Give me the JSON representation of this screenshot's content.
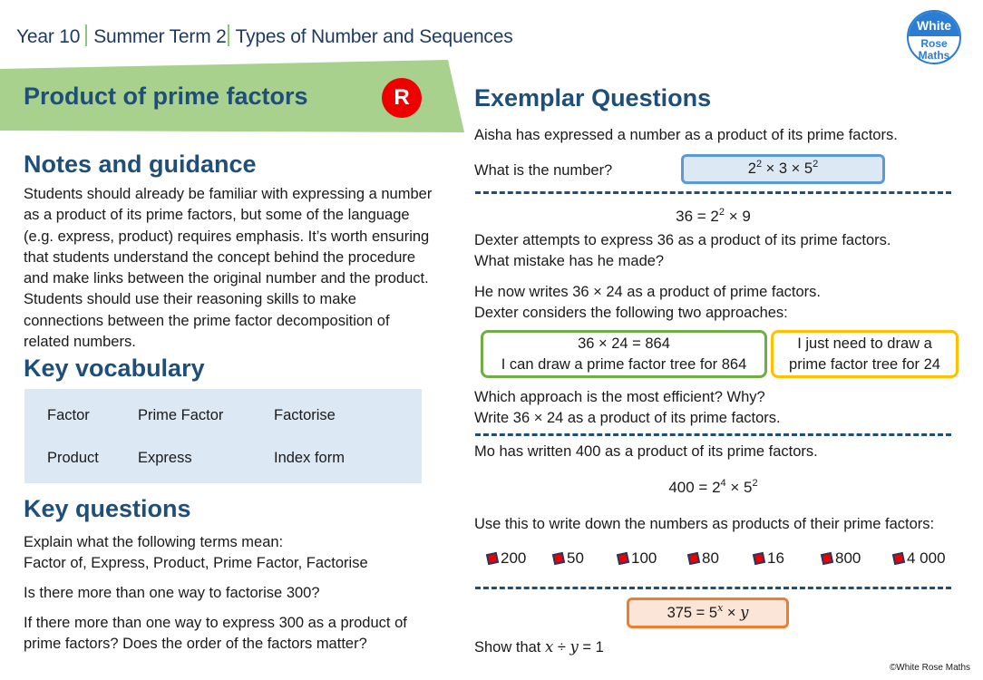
{
  "header": {
    "year": "Year 10",
    "term": "Summer Term 2",
    "unit": "Types of Number and Sequences"
  },
  "logo": {
    "line1": "White",
    "line2": "Rose",
    "line3": "Maths"
  },
  "colors": {
    "banner_green": "#a9d18e",
    "heading_blue": "#1f4e79",
    "badge_red": "#ee0000",
    "vocab_bg": "#dde8f5"
  },
  "banner": {
    "title": "Product of prime factors",
    "badge": "R"
  },
  "notes": {
    "title": "Notes and guidance",
    "lines": [
      "Students should already be familiar with expressing a number",
      "as a product of its prime factors, but some of the language",
      "(e.g. express, product) requires emphasis. It’s worth ensuring",
      "that students understand the concept behind the procedure",
      "and make links between the original number and the product.",
      "Students should use their reasoning skills to make",
      "connections between the prime factor decomposition of",
      "related numbers."
    ]
  },
  "vocabulary": {
    "title": "Key vocabulary",
    "items": [
      "Factor",
      "Prime Factor",
      "Factorise",
      "Product",
      "Express",
      "Index form"
    ]
  },
  "key_questions": {
    "title": "Key questions",
    "q1_line1": "Explain what the following terms mean:",
    "q1_line2": "Factor of,  Express, Product, Prime Factor, Factorise",
    "q2": "Is there more than one way to factorise 300?",
    "q3_line1": "If there more than one way to express 300 as a product of",
    "q3_line2": "prime factors? Does the order of the factors matter?"
  },
  "exemplar": {
    "title": "Exemplar Questions",
    "q1": {
      "text": "Aisha has expressed a number as a product of its prime factors.",
      "prompt": "What is the number?",
      "box": {
        "b1": "2",
        "e1": "2",
        "mid": " × 3 × ",
        "b2": "5",
        "e2": "2"
      }
    },
    "q2": {
      "eq_left": "36 = 2",
      "eq_exp": "2",
      "eq_right": " × 9",
      "line1": "Dexter attempts to express 36 as a product of its prime factors.",
      "line2": "What mistake has he made?",
      "line3": "He now writes 36 × 24 as a product of prime factors.",
      "line4": "Dexter considers the following two approaches:",
      "green_line1": "36 × 24 = 864",
      "green_line2": "I can draw a prime factor tree for 864",
      "yellow_line1": "I just need to draw a",
      "yellow_line2": "prime factor tree for 24",
      "line5": "Which approach is the most efficient?  Why?",
      "line6": "Write 36 × 24 as a product of its prime factors."
    },
    "q3": {
      "line1": "Mo has written 400 as a product of its prime factors.",
      "eq_left": "400 = 2",
      "eq_exp1": "4",
      "eq_mid": " × 5",
      "eq_exp2": "2",
      "line2": "Use this to write down the numbers as products of their prime factors:",
      "numbers": [
        "200",
        "50",
        "100",
        "80",
        "16",
        "800",
        "4 000"
      ]
    },
    "q4": {
      "box_left": "375 = 5",
      "box_exp": "x",
      "box_mid": " × ",
      "box_var": "y",
      "show_prefix": "Show that ",
      "show_x": "x",
      "show_div": " ÷ ",
      "show_y": "y",
      "show_suffix": " = 1"
    }
  },
  "footer": {
    "copyright": "©White Rose Maths"
  }
}
